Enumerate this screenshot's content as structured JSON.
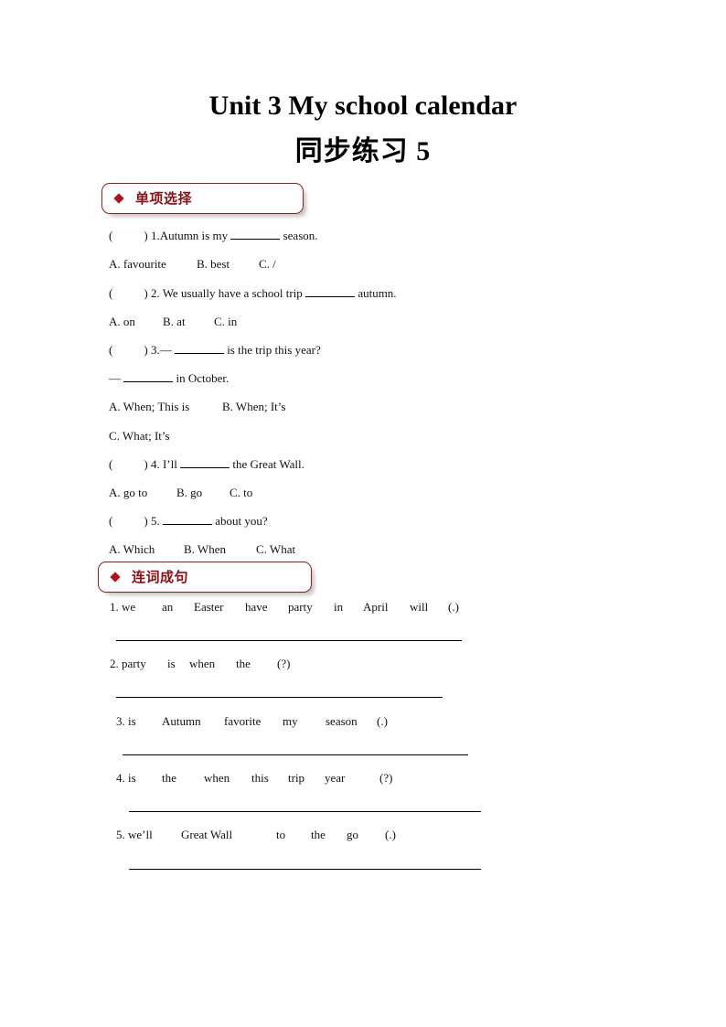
{
  "header": {
    "title_en": "Unit 3 My school calendar",
    "title_cn": "同步练习 5"
  },
  "sections": [
    {
      "label": "单项选择",
      "questions": [
        {
          "paren": "(",
          "paren_close": ")",
          "stem": "1.Autumn is my",
          "after": "season.",
          "options": [
            "A. favourite",
            "B. best",
            "C. /"
          ]
        },
        {
          "paren": "(",
          "paren_close": ")",
          "stem": "2. We usually have a school trip",
          "after": "autumn.",
          "options": [
            "A. on",
            "B. at",
            "C. in"
          ]
        },
        {
          "paren": "(",
          "paren_close": ")",
          "stem": "3.—",
          "after": "is the trip this year?",
          "line2_prefix": "—",
          "line2_after": "in October.",
          "options": [
            "A. When; This is",
            "B. When; It’s",
            "C. What; It’s"
          ]
        },
        {
          "paren": "(",
          "paren_close": ")",
          "stem": "4. I’ll",
          "after": "the Great Wall.",
          "options": [
            "A. go to",
            "B. go",
            "C. to"
          ]
        },
        {
          "paren": "(",
          "paren_close": ")",
          "stem": "5.",
          "after": "about you?",
          "options": [
            "A. Which",
            "B. When",
            "C. What"
          ]
        }
      ]
    },
    {
      "label": "连词成句",
      "items": [
        {
          "words": [
            "1. we",
            "an",
            "Easter",
            "have",
            "party",
            "in",
            "April",
            "will",
            "(.)"
          ]
        },
        {
          "words": [
            "2. party",
            "is",
            "when",
            "the",
            "(?)"
          ]
        },
        {
          "words": [
            "3. is",
            "Autumn",
            "favorite",
            "my",
            "season",
            "(.)"
          ]
        },
        {
          "words": [
            "4. is",
            "the",
            "when",
            "this",
            "trip",
            "year",
            "(?)"
          ]
        },
        {
          "words": [
            "5. we’ll",
            "Great Wall",
            "to",
            "the",
            "go",
            "(.)"
          ]
        }
      ]
    }
  ],
  "colors": {
    "section_border": "#9b1c1c",
    "section_text": "#8b0f14",
    "diamond": "#b0121b"
  }
}
